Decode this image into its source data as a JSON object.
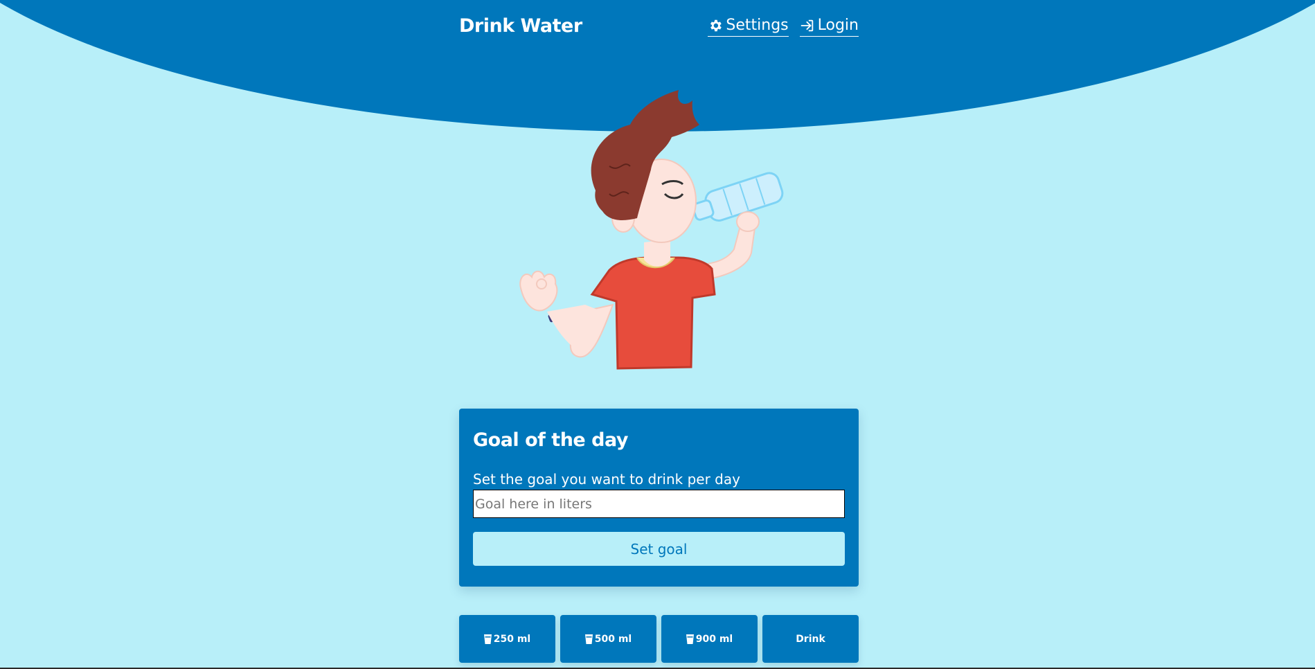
{
  "header": {
    "brand": "Drink Water",
    "nav": {
      "settings_label": "Settings",
      "settings_icon": "gear-icon",
      "login_label": "Login",
      "login_icon": "sign-in-icon"
    }
  },
  "goal_card": {
    "title": "Goal of the day",
    "description": "Set the goal you want to drink per day",
    "input_placeholder": "Goal here in liters",
    "input_value": "",
    "button_label": "Set goal"
  },
  "drink_buttons": [
    {
      "label": "250 ml",
      "icon": "glass-icon"
    },
    {
      "label": "500 ml",
      "icon": "glass-icon"
    },
    {
      "label": "900 ml",
      "icon": "glass-icon"
    },
    {
      "label": "Drink",
      "icon": ""
    }
  ],
  "colors": {
    "primary": "#0077bb",
    "background": "#b8eff9",
    "text_on_primary": "#ffffff"
  }
}
